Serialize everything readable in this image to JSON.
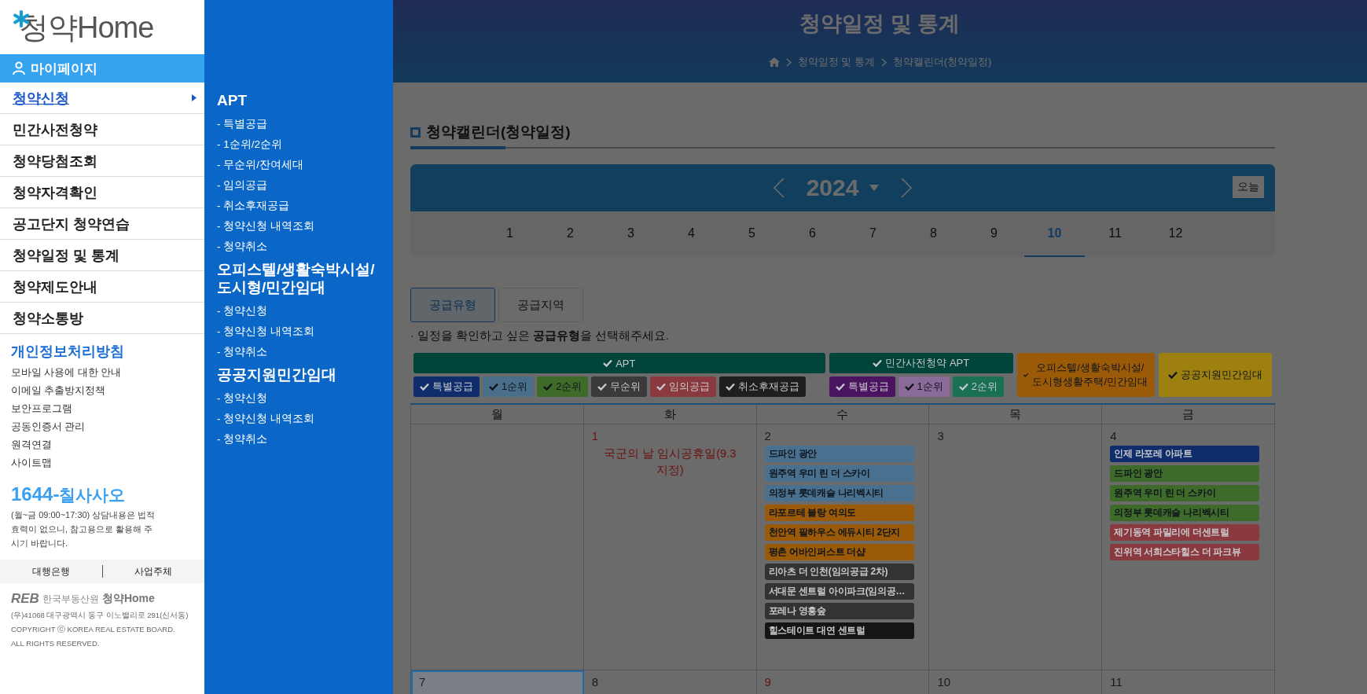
{
  "sidebar": {
    "logo": "청약Home",
    "mypage": "마이페이지",
    "menu": [
      {
        "label": "청약신청",
        "selected": true
      },
      {
        "label": "민간사전청약",
        "selected": false
      },
      {
        "label": "청약당첨조회",
        "selected": false
      },
      {
        "label": "청약자격확인",
        "selected": false
      },
      {
        "label": "공고단지 청약연습",
        "selected": false
      },
      {
        "label": "청약일정 및 통계",
        "selected": false
      },
      {
        "label": "청약제도안내",
        "selected": false
      },
      {
        "label": "청약소통방",
        "selected": false
      }
    ],
    "policy_title": "개인정보처리방침",
    "links": [
      "모바일 사용에 대한 안내",
      "이메일 추출방지정책",
      "보안프로그램",
      "공동인증서 관리",
      "원격연결",
      "사이트맵"
    ],
    "phone_prefix": "1644-",
    "phone_word": "칠사사오",
    "notice": "(월~금 09:00~17:30) 상담내용은 법적효력이 없으니, 참고용으로 활용해 주시기 바랍니다.",
    "bottom_links": [
      "대행은행",
      "사업주체"
    ],
    "footer": {
      "org_mark": "REB",
      "org_name": "한국부동산원",
      "logo": "청약Home",
      "address": "(우)41068 대구광역시 동구 이노밸리로 291(신서동)",
      "copyright": "COPYRIGHT ⓒ KOREA REAL ESTATE BOARD.",
      "rights": "ALL RIGHTS RESERVED."
    }
  },
  "submenu": [
    {
      "title": "APT",
      "items": [
        "- 특별공급",
        "- 1순위/2순위",
        "- 무순위/잔여세대",
        "- 임의공급",
        "- 취소후재공급",
        "- 청약신청 내역조회",
        "- 청약취소"
      ]
    },
    {
      "title": "오피스텔/생활숙박시설/도시형/민간임대",
      "items": [
        "- 청약신청",
        "- 청약신청 내역조회",
        "- 청약취소"
      ]
    },
    {
      "title": "공공지원민간임대",
      "items": [
        "- 청약신청",
        "- 청약신청 내역조회",
        "- 청약취소"
      ]
    }
  ],
  "header": {
    "title": "청약일정 및 통계",
    "breadcrumb": [
      "청약일정 및 통계",
      "청약캘린더(청약일정)"
    ]
  },
  "section_title": "청약캘린더(청약일정)",
  "year": "2024",
  "today_button": "오늘",
  "months": [
    {
      "label": "1",
      "selected": false
    },
    {
      "label": "2",
      "selected": false
    },
    {
      "label": "3",
      "selected": false
    },
    {
      "label": "4",
      "selected": false
    },
    {
      "label": "5",
      "selected": false
    },
    {
      "label": "6",
      "selected": false
    },
    {
      "label": "7",
      "selected": false
    },
    {
      "label": "8",
      "selected": false
    },
    {
      "label": "9",
      "selected": false
    },
    {
      "label": "10",
      "selected": true
    },
    {
      "label": "11",
      "selected": false
    },
    {
      "label": "12",
      "selected": false
    }
  ],
  "tabs": [
    {
      "label": "공급유형",
      "selected": true
    },
    {
      "label": "공급지역",
      "selected": false
    }
  ],
  "instruction": "· 일정을 확인하고 싶은 **공급유형**을 선택해주세요.",
  "filters": [
    {
      "label": "APT",
      "color": "#00443a",
      "checked": true,
      "children": [
        {
          "label": "특별공급",
          "color": "#0f2d6b",
          "checked": true
        },
        {
          "label": "1순위",
          "color": "#4a6f8a",
          "checked": true
        },
        {
          "label": "2순위",
          "color": "#3f6b2a",
          "checked": true
        },
        {
          "label": "무순위",
          "color": "#3a3a3a",
          "checked": true
        },
        {
          "label": "임의공급",
          "color": "#8a3a3e",
          "checked": true
        },
        {
          "label": "취소후재공급",
          "color": "#1e1e1e",
          "checked": true
        }
      ]
    },
    {
      "label": "민간사전청약 APT",
      "color": "#00443a",
      "checked": true,
      "children": [
        {
          "label": "특별공급",
          "color": "#4a1460",
          "checked": true
        },
        {
          "label": "1순위",
          "color": "#8a6a98",
          "checked": true
        },
        {
          "label": "2순위",
          "color": "#197055",
          "checked": true
        }
      ]
    },
    {
      "label": "오피스텔/생활숙박시설/도시형생활주택/민간임대",
      "color": "#9a5a08",
      "checked": true
    },
    {
      "label": "공공지원민간임대",
      "color": "#9d8010",
      "checked": true
    }
  ],
  "weekdays": [
    "월",
    "화",
    "수",
    "목",
    "금"
  ],
  "weeks": [
    {
      "days": [
        {
          "selected": false
        },
        {
          "date": "1",
          "holiday": true,
          "selected": false,
          "note": "국군의 날 임시공휴일(9.3 지정)"
        },
        {
          "date": "2",
          "holiday": false,
          "selected": false,
          "events": [
            {
              "title": "드파인 광안",
              "color": "#4a7090"
            },
            {
              "title": "원주역 우미 린 더 스카이",
              "color": "#4a7090"
            },
            {
              "title": "의정부 롯데캐슬 나리벡시티",
              "color": "#4a7090"
            },
            {
              "title": "라포르테 블랑 여의도",
              "color": "#9a5a08"
            },
            {
              "title": "천안역 필하우스 에듀시티 2단지",
              "color": "#9a5a08"
            },
            {
              "title": "평촌 어바인퍼스트 더샵",
              "color": "#9a5a08"
            },
            {
              "title": "리아츠 더 인천(임의공급 2차)",
              "color": "#333333"
            },
            {
              "title": "서대문 센트럴 아이파크(임의공…",
              "color": "#333333"
            },
            {
              "title": "포레나 영흥숲",
              "color": "#333333"
            },
            {
              "title": "힐스테이트 대연 센트럴",
              "color": "#151515"
            }
          ]
        },
        {
          "date": "3",
          "holiday": false,
          "selected": false
        },
        {
          "date": "4",
          "holiday": false,
          "selected": false,
          "events": [
            {
              "title": "인제 라포레 아파트",
              "color": "#0f2d6b"
            },
            {
              "title": "드파인 광안",
              "color": "#3f6b2a"
            },
            {
              "title": "원주역 우미 린 더 스카이",
              "color": "#3f6b2a"
            },
            {
              "title": "의정부 롯데캐슬 나리벡시티",
              "color": "#3f6b2a"
            },
            {
              "title": "제기동역 파밀리에 더센트럴",
              "color": "#8a3a3e"
            },
            {
              "title": "진위역 서희스타힐스 더 파크뷰",
              "color": "#8a3a3e"
            }
          ]
        }
      ]
    },
    {
      "days": [
        {
          "date": "7",
          "holiday": false,
          "selected": true
        },
        {
          "date": "8",
          "holiday": false,
          "selected": false
        },
        {
          "date": "9",
          "holiday": true,
          "selected": false
        },
        {
          "date": "10",
          "holiday": false,
          "selected": false
        },
        {
          "date": "11",
          "holiday": false,
          "selected": false
        }
      ]
    }
  ]
}
